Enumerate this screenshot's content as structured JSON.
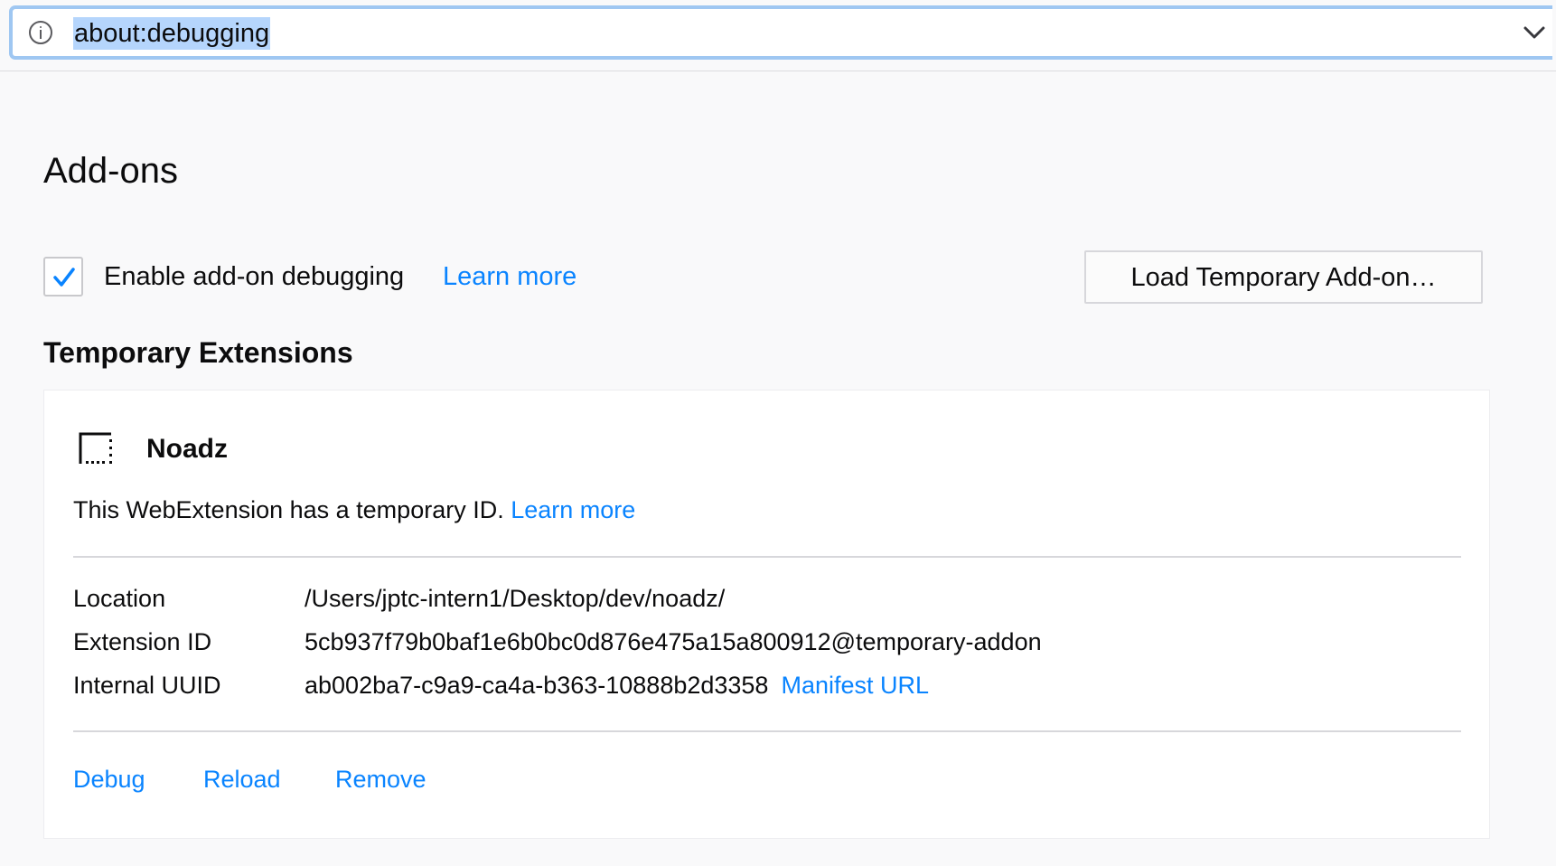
{
  "urlbar": {
    "url": "about:debugging",
    "info_icon": "info-icon",
    "dropdown_icon": "chevron-down-icon"
  },
  "page": {
    "title": "Add-ons",
    "enable_debugging": {
      "label": "Enable add-on debugging",
      "checked": true,
      "learn_more": "Learn more"
    },
    "load_button": "Load Temporary Add-on…",
    "section_title": "Temporary Extensions"
  },
  "extension": {
    "name": "Noadz",
    "icon": "extension-placeholder-icon",
    "temp_id_message": "This WebExtension has a temporary ID.",
    "learn_more": "Learn more",
    "details": [
      {
        "label": "Location",
        "value": "/Users/jptc-intern1/Desktop/dev/noadz/"
      },
      {
        "label": "Extension ID",
        "value": "5cb937f79b0baf1e6b0bc0d876e475a15a800912@temporary-addon"
      },
      {
        "label": "Internal UUID",
        "value": "ab002ba7-c9a9-ca4a-b363-10888b2d3358"
      }
    ],
    "manifest_link": "Manifest URL",
    "actions": {
      "debug": "Debug",
      "reload": "Reload",
      "remove": "Remove"
    }
  },
  "colors": {
    "link": "#0a84ff",
    "checkmark": "#0a84ff",
    "url_selection": "#b5d5fc",
    "urlbar_focus": "#9fc7f2",
    "page_background": "#f9f9fa"
  }
}
